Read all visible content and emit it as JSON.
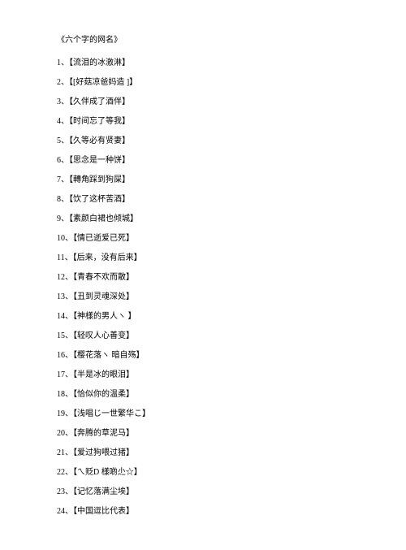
{
  "title": "《六个字的网名》",
  "items": [
    "1、【流泪的冰激淋】",
    "2、【[好菇凉爸妈造 ]】",
    "3、【久伴成了酒伴】",
    "4、【时间忘了等我】",
    "5、【久等必有贤妻】",
    "6、【思念是一种饼】",
    "7、【轉角踩到狗屎】",
    "8、【饮了这杯苦酒】",
    "9、【素颜白裙也倾城】",
    "10、【情已逝爱已死】",
    "11、【后来，没有后来】",
    "12、【青春不欢而散】",
    "13、【丑到灵魂深处】",
    "14、【神樣的男人ヽ 】",
    "15、【轻叹人心善变】",
    "16、【樱花落ヽ 暗自殇】",
    "17、【半是冰的眼泪】",
    "18、【恰似你的温柔】",
    "19、【浅唱じ一世繁华こ】",
    "20、【奔腾的草泥马】",
    "21、【爱过狗喂过猪】",
    "22、【ㄟ贬D 樣啲尐☆】",
    "23、【记忆落满尘埃】",
    "24、【中国逗比代表】"
  ]
}
